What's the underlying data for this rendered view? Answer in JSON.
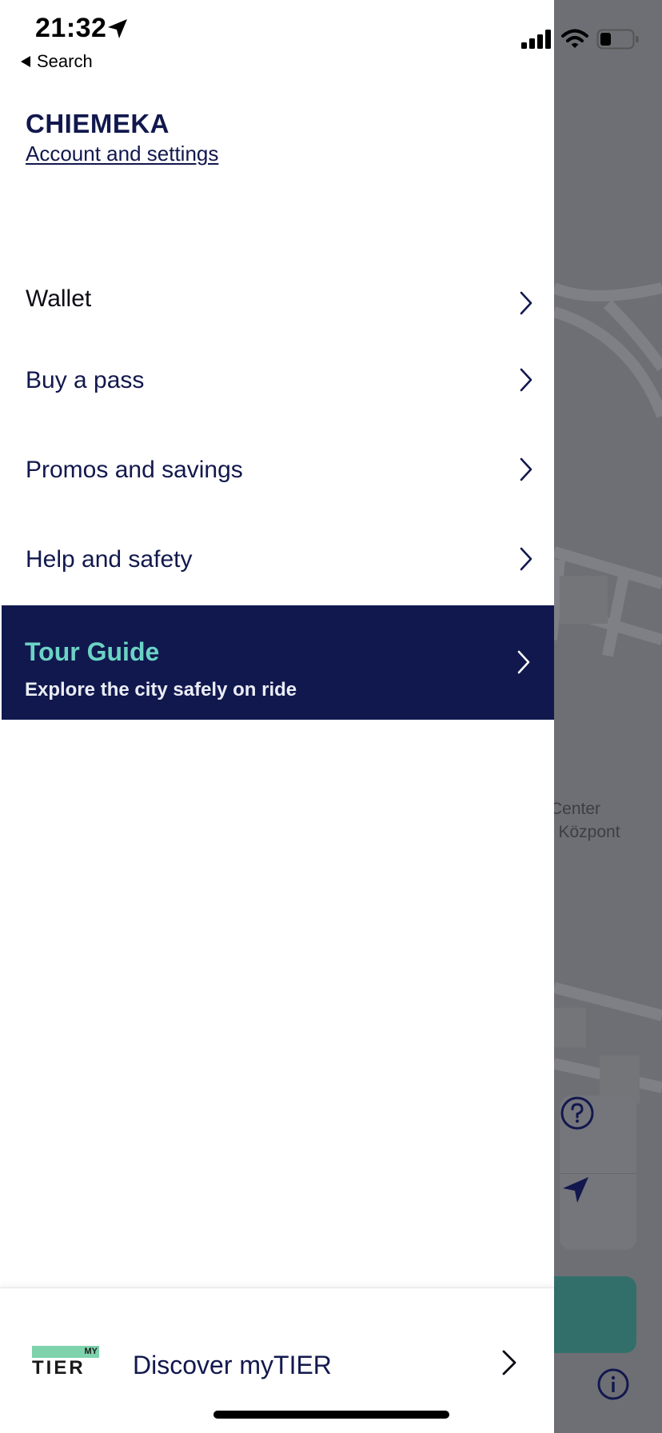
{
  "status_bar": {
    "time": "21:32",
    "back_label": "Search"
  },
  "profile": {
    "name": "CHIEMEKA",
    "account_link": "Account and settings"
  },
  "menu": {
    "items": [
      {
        "label": "Wallet"
      },
      {
        "label": "Buy a pass"
      },
      {
        "label": "Promos and savings"
      },
      {
        "label": "Help and safety"
      }
    ]
  },
  "tour_guide": {
    "title": "Tour Guide",
    "subtitle": "Explore the city safely on ride"
  },
  "bottom": {
    "logo_my": "MY",
    "logo_word": "TIER",
    "discover_label": "Discover myTIER"
  },
  "map": {
    "label_line1": "Center",
    "label_line2": "i Központ"
  },
  "colors": {
    "brand_navy": "#12184d",
    "accent_teal": "#6cd3c4",
    "logo_green": "#7ed2ac",
    "map_overlay": "#6e6f75"
  },
  "icons": {
    "status_location": "location-arrow-icon",
    "signal": "signal-bars-icon",
    "wifi": "wifi-icon",
    "battery": "battery-icon",
    "chevron": "chevron-right-icon",
    "help": "question-circle-icon",
    "locate": "navigation-arrow-icon",
    "info": "info-circle-icon"
  }
}
